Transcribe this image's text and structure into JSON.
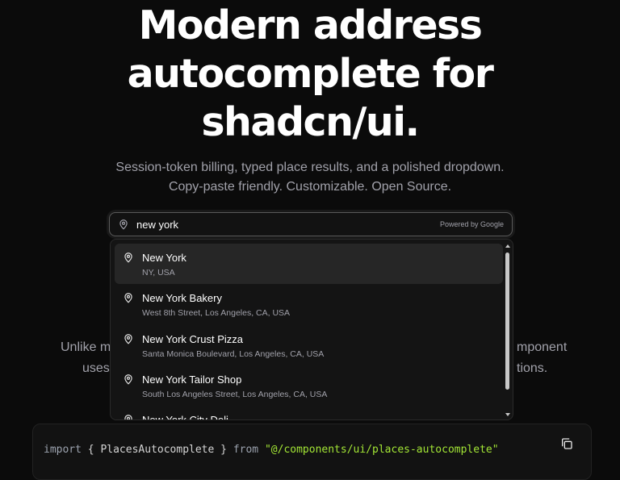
{
  "hero": {
    "title_lines": [
      "Modern address",
      "autocomplete for",
      "shadcn/ui."
    ],
    "subtitle_lines": [
      "Session-token billing, typed place results, and a polished dropdown.",
      "Copy-paste friendly. Customizable. Open Source."
    ]
  },
  "background_text": {
    "left_line1": "Unlike m",
    "left_line2": "uses",
    "right_line1": "mponent",
    "right_line2": "tions."
  },
  "search": {
    "value": "new york",
    "placeholder": "",
    "powered_by": "Powered by Google",
    "icon": "map-pin-icon"
  },
  "suggestions": [
    {
      "name": "New York",
      "address": "NY, USA",
      "active": true
    },
    {
      "name": "New York Bakery",
      "address": "West 8th Street, Los Angeles, CA, USA",
      "active": false
    },
    {
      "name": "New York Crust Pizza",
      "address": "Santa Monica Boulevard, Los Angeles, CA, USA",
      "active": false
    },
    {
      "name": "New York Tailor Shop",
      "address": "South Los Angeles Street, Los Angeles, CA, USA",
      "active": false
    },
    {
      "name": "New York City Deli",
      "address": "",
      "active": false
    }
  ],
  "code": {
    "kw_import": "import",
    "brace_open": "{",
    "identifier": "PlacesAutocomplete",
    "brace_close": "}",
    "kw_from": "from",
    "module": "\"@/components/ui/places-autocomplete\"",
    "copy_icon": "copy-icon"
  },
  "colors": {
    "background": "#0b0b0b",
    "highlight": "#262626",
    "string": "#a3e635",
    "muted": "#a1a1aa"
  }
}
